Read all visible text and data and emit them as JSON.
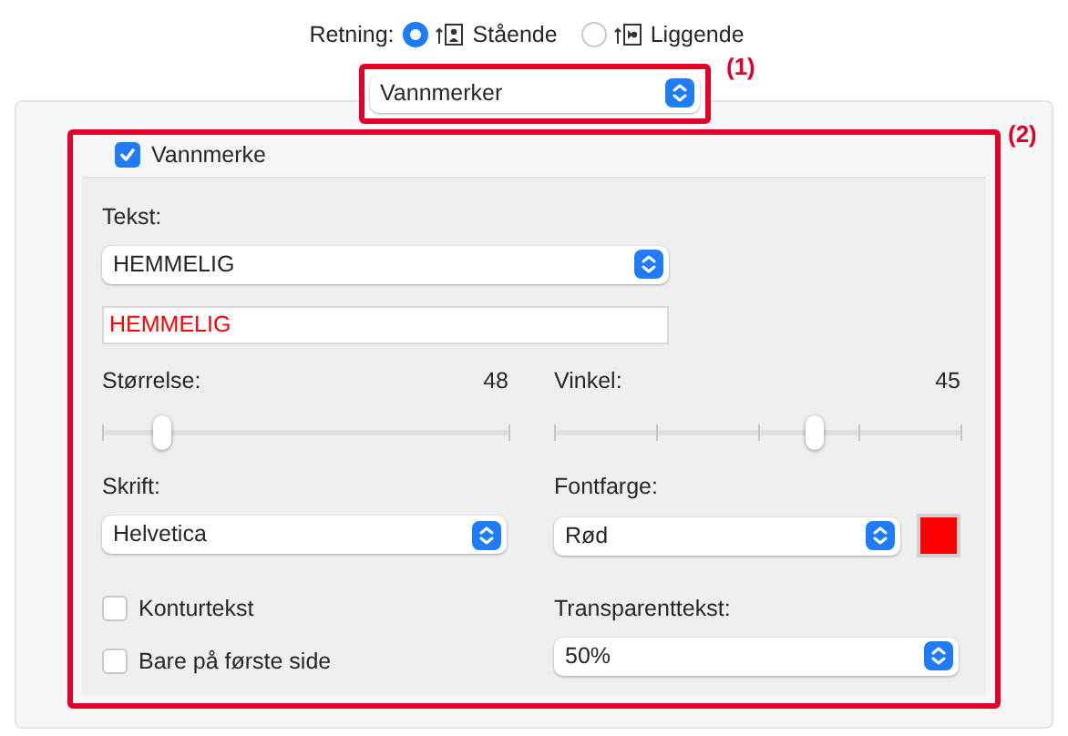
{
  "orientation": {
    "label": "Retning:",
    "options": [
      {
        "label": "Stående",
        "kind": "portrait",
        "selected": true
      },
      {
        "label": "Liggende",
        "kind": "landscape",
        "selected": false
      }
    ]
  },
  "section_popup": {
    "value": "Vannmerker",
    "annotation": "(1)"
  },
  "watermark": {
    "annotation": "(2)",
    "enable": {
      "label": "Vannmerke",
      "checked": true
    },
    "text": {
      "label": "Tekst:",
      "popup_value": "HEMMELIG",
      "field_value": "HEMMELIG"
    },
    "size": {
      "label": "Størrelse:",
      "reading": "48",
      "level": 0.15
    },
    "angle": {
      "label": "Vinkel:",
      "reading": "45",
      "level": 0.64
    },
    "font": {
      "label": "Skrift:",
      "value": "Helvetica"
    },
    "font_color": {
      "label": "Fontfarge:",
      "value": "Rød",
      "color": "#ff0000"
    },
    "options": [
      {
        "label": "Konturtekst",
        "checked": false
      },
      {
        "label": "Bare på første side",
        "checked": false
      }
    ],
    "transparency": {
      "label": "Transparenttekst:",
      "value": "50%"
    }
  }
}
